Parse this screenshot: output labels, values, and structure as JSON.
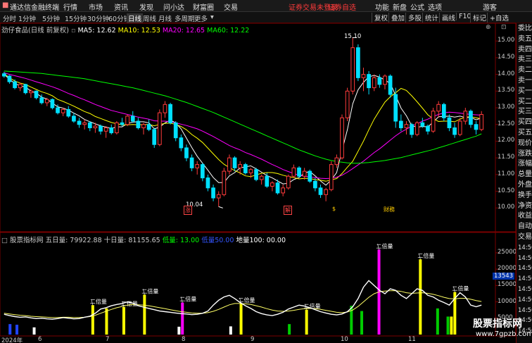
{
  "app": {
    "title": "通达信金融终端",
    "menu": [
      "行情",
      "市场",
      "资讯",
      "发现",
      "问小达",
      "财富圈",
      "交易"
    ],
    "warning": "证券交易未登录",
    "warning2": "证券自选",
    "right_menu": [
      "功能",
      "新盘",
      "公式",
      "选项",
      "游客"
    ]
  },
  "toolbar": {
    "periods": [
      "分时",
      "1分钟",
      "5分钟",
      "15分钟",
      "30分钟",
      "60分钟",
      "日线",
      "周线",
      "月线",
      "多周期",
      "更多"
    ],
    "active": "日线",
    "right": [
      "复权",
      "叠加",
      "多股",
      "统计",
      "画线",
      "F10",
      "标记",
      "+自选"
    ]
  },
  "stock": {
    "name": "劲仔食品(日线 前复权)",
    "ma5": "MA5: 12.62",
    "ma10": "MA10: 12.53",
    "ma20": "MA20: 12.65",
    "ma60": "MA60: 12.22",
    "high_label": "15.10",
    "low_label": "10.04",
    "event_labels": [
      "涨",
      "解",
      "$",
      "财務"
    ]
  },
  "price_axis": [
    "15.00",
    "14.50",
    "14.00",
    "13.50",
    "13.00",
    "12.50",
    "12.00",
    "11.50",
    "11.00",
    "10.50",
    "10.00"
  ],
  "indicator": {
    "name": "股票指标网",
    "five_day": "五日量: 79922.88",
    "ten_day": "十日量: 81155.65",
    "low": "低量: 13.00",
    "low2": "低量50.00",
    "ground": "地量100: 00.00",
    "double_label": "二倍量",
    "current_value": "13543"
  },
  "volume_axis": [
    "25000",
    "20000",
    "15000",
    "10000",
    "5000"
  ],
  "date_axis": [
    "2024年",
    "6",
    "7",
    "8",
    "9",
    "10",
    "11"
  ],
  "right_panel": [
    "委比",
    "卖五",
    "卖四",
    "卖三",
    "卖二",
    "卖一",
    "买一",
    "买二",
    "买三",
    "买四",
    "买五",
    "现价",
    "涨跌",
    "涨幅",
    "总量",
    "外盘",
    "换手",
    "净资",
    "收益",
    "自动",
    "交易",
    "14:50",
    "14:50",
    "14:50",
    "14:50",
    "14:50",
    "14:50",
    "14:50",
    "14:50",
    "14:50"
  ],
  "watermark": "股票指标网",
  "watermark_url": "www.7gpzb.com",
  "colors": {
    "up": "#ff3b3b",
    "down": "#00e0ff",
    "ma5": "#ffffff",
    "ma10": "#ffff00",
    "ma20": "#ff00ff",
    "ma60": "#00ff00",
    "double_vol": "#ffff00",
    "magenta": "#ff00ff",
    "green_bar": "#00cc00"
  },
  "candles": [
    [
      14.02,
      14.08,
      13.9,
      13.95
    ],
    [
      13.95,
      13.98,
      13.72,
      13.78
    ],
    [
      13.78,
      13.85,
      13.55,
      13.6
    ],
    [
      13.6,
      13.75,
      13.5,
      13.7
    ],
    [
      13.7,
      13.72,
      13.4,
      13.45
    ],
    [
      13.45,
      13.55,
      13.3,
      13.5
    ],
    [
      13.5,
      13.52,
      13.25,
      13.3
    ],
    [
      13.3,
      13.4,
      13.1,
      13.15
    ],
    [
      13.15,
      13.3,
      13.05,
      13.25
    ],
    [
      13.25,
      13.28,
      12.95,
      13.0
    ],
    [
      13.0,
      13.1,
      12.8,
      12.85
    ],
    [
      12.85,
      13.0,
      12.75,
      12.95
    ],
    [
      12.95,
      13.05,
      12.7,
      12.75
    ],
    [
      12.75,
      12.85,
      12.55,
      12.6
    ],
    [
      12.6,
      12.7,
      12.4,
      12.5
    ],
    [
      12.5,
      12.65,
      12.35,
      12.55
    ],
    [
      12.55,
      12.6,
      12.3,
      12.4
    ],
    [
      12.4,
      12.55,
      12.25,
      12.45
    ],
    [
      12.45,
      12.5,
      12.2,
      12.3
    ],
    [
      12.3,
      12.45,
      12.1,
      12.4
    ],
    [
      12.4,
      12.5,
      12.2,
      12.25
    ],
    [
      12.25,
      12.6,
      12.2,
      12.55
    ],
    [
      12.55,
      12.7,
      12.45,
      12.5
    ],
    [
      12.5,
      12.8,
      12.45,
      12.75
    ],
    [
      12.75,
      12.9,
      12.55,
      12.6
    ],
    [
      12.6,
      12.7,
      12.35,
      12.4
    ],
    [
      12.4,
      12.55,
      12.2,
      12.5
    ],
    [
      12.5,
      12.65,
      12.3,
      12.35
    ],
    [
      12.35,
      12.4,
      11.8,
      11.9
    ],
    [
      11.9,
      12.95,
      11.85,
      12.85
    ],
    [
      12.85,
      13.2,
      12.7,
      13.1
    ],
    [
      13.1,
      13.15,
      12.5,
      12.55
    ],
    [
      12.55,
      12.6,
      12.0,
      12.1
    ],
    [
      12.1,
      12.2,
      11.7,
      11.8
    ],
    [
      11.8,
      11.9,
      11.4,
      11.5
    ],
    [
      11.5,
      11.6,
      11.1,
      11.2
    ],
    [
      11.2,
      11.4,
      11.0,
      11.3
    ],
    [
      11.3,
      11.35,
      10.8,
      10.9
    ],
    [
      10.9,
      11.0,
      10.5,
      10.6
    ],
    [
      10.6,
      10.7,
      10.2,
      10.3
    ],
    [
      10.3,
      10.5,
      10.04,
      10.4
    ],
    [
      10.4,
      11.2,
      10.35,
      11.1
    ],
    [
      11.1,
      11.6,
      11.0,
      11.5
    ],
    [
      11.5,
      11.55,
      11.1,
      11.2
    ],
    [
      11.2,
      11.4,
      11.0,
      11.3
    ],
    [
      11.3,
      11.35,
      11.0,
      11.05
    ],
    [
      11.05,
      11.2,
      10.9,
      11.15
    ],
    [
      11.15,
      11.2,
      10.8,
      10.85
    ],
    [
      10.85,
      11.0,
      10.7,
      10.95
    ],
    [
      10.95,
      11.05,
      10.6,
      10.65
    ],
    [
      10.65,
      10.8,
      10.5,
      10.75
    ],
    [
      10.75,
      10.85,
      10.4,
      10.45
    ],
    [
      10.45,
      10.7,
      10.35,
      10.6
    ],
    [
      10.6,
      11.0,
      10.55,
      10.95
    ],
    [
      10.95,
      11.3,
      10.9,
      11.2
    ],
    [
      11.2,
      11.25,
      10.9,
      10.95
    ],
    [
      10.95,
      11.2,
      10.85,
      11.1
    ],
    [
      11.1,
      11.15,
      10.75,
      10.8
    ],
    [
      10.8,
      10.9,
      10.5,
      10.6
    ],
    [
      10.6,
      10.7,
      10.3,
      10.4
    ],
    [
      10.4,
      10.6,
      10.2,
      10.55
    ],
    [
      10.55,
      11.4,
      10.5,
      11.3
    ],
    [
      11.3,
      11.6,
      11.2,
      11.5
    ],
    [
      11.5,
      12.8,
      11.45,
      12.7
    ],
    [
      12.7,
      13.6,
      12.6,
      13.5
    ],
    [
      13.5,
      15.1,
      13.4,
      14.8
    ],
    [
      14.8,
      14.9,
      13.8,
      13.9
    ],
    [
      13.9,
      14.2,
      13.5,
      14.0
    ],
    [
      14.0,
      14.1,
      13.4,
      13.6
    ],
    [
      13.6,
      14.0,
      13.5,
      13.9
    ],
    [
      13.9,
      14.0,
      13.6,
      13.7
    ],
    [
      13.7,
      14.0,
      13.55,
      13.95
    ],
    [
      13.95,
      14.0,
      13.3,
      13.4
    ],
    [
      13.4,
      13.6,
      12.4,
      12.6
    ],
    [
      12.6,
      12.8,
      12.3,
      12.4
    ],
    [
      12.4,
      12.6,
      12.2,
      12.5
    ],
    [
      12.5,
      12.55,
      12.1,
      12.2
    ],
    [
      12.2,
      12.6,
      12.15,
      12.55
    ],
    [
      12.55,
      12.7,
      12.4,
      12.45
    ],
    [
      12.45,
      12.5,
      12.2,
      12.3
    ],
    [
      12.3,
      13.0,
      12.25,
      12.9
    ],
    [
      12.9,
      13.2,
      12.7,
      13.1
    ],
    [
      13.1,
      13.15,
      12.6,
      12.7
    ],
    [
      12.7,
      12.8,
      12.3,
      12.4
    ],
    [
      12.4,
      12.55,
      12.1,
      12.2
    ],
    [
      12.2,
      12.7,
      12.15,
      12.6
    ],
    [
      12.6,
      13.0,
      12.5,
      12.9
    ],
    [
      12.9,
      12.95,
      12.4,
      12.5
    ],
    [
      12.5,
      12.6,
      12.2,
      12.35
    ],
    [
      12.35,
      12.9,
      12.3,
      12.8
    ]
  ],
  "ma": {
    "ma5": [
      14.0,
      13.86,
      13.72,
      13.66,
      13.62,
      13.5,
      13.44,
      13.32,
      13.26,
      13.14,
      13.03,
      12.99,
      12.93,
      12.84,
      12.76,
      12.65,
      12.58,
      12.52,
      12.46,
      12.42,
      12.38,
      12.43,
      12.43,
      12.53,
      12.57,
      12.58,
      12.58,
      12.55,
      12.37,
      12.42,
      12.55,
      12.63,
      12.55,
      12.37,
      12.09,
      11.81,
      11.55,
      11.34,
      11.13,
      10.91,
      10.76,
      10.76,
      10.96,
      11.06,
      11.2,
      11.23,
      11.26,
      11.17,
      11.07,
      10.97,
      10.9,
      10.81,
      10.72,
      10.74,
      10.85,
      10.91,
      11.05,
      11.09,
      10.96,
      10.81,
      10.68,
      10.84,
      11.06,
      11.72,
      12.34,
      13.12,
      13.54,
      13.76,
      13.93,
      13.97,
      13.92,
      13.83,
      13.73,
      13.37,
      12.99,
      12.76,
      12.46,
      12.42,
      12.44,
      12.43,
      12.57,
      12.73,
      12.74,
      12.75,
      12.72,
      12.75,
      12.71,
      12.71,
      12.64,
      12.69
    ],
    "ma10": [
      14.02,
      13.9,
      13.8,
      13.74,
      13.7,
      13.62,
      13.55,
      13.48,
      13.43,
      13.36,
      13.25,
      13.19,
      13.12,
      13.05,
      12.97,
      12.89,
      12.83,
      12.74,
      12.68,
      12.62,
      12.56,
      12.52,
      12.49,
      12.49,
      12.5,
      12.49,
      12.5,
      12.5,
      12.46,
      12.5,
      12.53,
      12.54,
      12.5,
      12.44,
      12.34,
      12.2,
      12.09,
      11.96,
      11.79,
      11.62,
      11.45,
      11.31,
      11.21,
      11.12,
      11.05,
      10.96,
      10.94,
      10.99,
      11.04,
      11.06,
      11.06,
      11.03,
      10.98,
      10.94,
      10.91,
      10.87,
      10.89,
      10.88,
      10.85,
      10.83,
      10.8,
      10.84,
      10.88,
      11.03,
      11.22,
      11.4,
      11.7,
      12.0,
      12.34,
      12.66,
      12.92,
      13.17,
      13.33,
      13.45,
      13.58,
      13.52,
      13.36,
      13.18,
      12.99,
      12.79,
      12.67,
      12.59,
      12.6,
      12.6,
      12.58,
      12.66,
      12.72,
      12.73,
      12.7,
      12.67
    ],
    "ma20": [
      14.05,
      14.0,
      13.96,
      13.92,
      13.88,
      13.83,
      13.78,
      13.73,
      13.68,
      13.63,
      13.57,
      13.5,
      13.43,
      13.37,
      13.3,
      13.24,
      13.17,
      13.1,
      13.04,
      12.98,
      12.92,
      12.88,
      12.84,
      12.8,
      12.76,
      12.72,
      12.69,
      12.66,
      12.61,
      12.6,
      12.6,
      12.58,
      12.55,
      12.51,
      12.47,
      12.42,
      12.37,
      12.3,
      12.22,
      12.14,
      12.05,
      11.96,
      11.87,
      11.8,
      11.74,
      11.66,
      11.6,
      11.53,
      11.46,
      11.38,
      11.3,
      11.23,
      11.15,
      11.09,
      11.03,
      10.98,
      10.95,
      10.93,
      10.91,
      10.89,
      10.88,
      10.89,
      10.92,
      10.98,
      11.07,
      11.18,
      11.29,
      11.4,
      11.53,
      11.66,
      11.77,
      11.9,
      12.03,
      12.16,
      12.27,
      12.36,
      12.45,
      12.52,
      12.6,
      12.66,
      12.74,
      12.8,
      12.85,
      12.87,
      12.86,
      12.84,
      12.82,
      12.8,
      12.79,
      12.78
    ],
    "ma60": [
      14.1,
      14.09,
      14.08,
      14.07,
      14.06,
      14.05,
      14.04,
      14.03,
      14.01,
      13.99,
      13.97,
      13.95,
      13.93,
      13.91,
      13.89,
      13.87,
      13.84,
      13.81,
      13.78,
      13.75,
      13.72,
      13.69,
      13.66,
      13.63,
      13.6,
      13.56,
      13.52,
      13.48,
      13.44,
      13.4,
      13.36,
      13.31,
      13.26,
      13.21,
      13.16,
      13.1,
      13.04,
      12.98,
      12.92,
      12.86,
      12.79,
      12.72,
      12.65,
      12.58,
      12.51,
      12.44,
      12.37,
      12.3,
      12.23,
      12.16,
      12.09,
      12.02,
      11.95,
      11.88,
      11.81,
      11.74,
      11.68,
      11.62,
      11.56,
      11.51,
      11.46,
      11.42,
      11.39,
      11.37,
      11.35,
      11.34,
      11.34,
      11.35,
      11.36,
      11.38,
      11.4,
      11.42,
      11.45,
      11.48,
      11.51,
      11.55,
      11.59,
      11.63,
      11.67,
      11.71,
      11.75,
      11.8,
      11.85,
      11.9,
      11.95,
      12.0,
      12.05,
      12.1,
      12.15,
      12.22
    ]
  },
  "volume_line1": [
    6200,
    5800,
    5500,
    5300,
    5400,
    5100,
    4900,
    5000,
    4800,
    4700,
    4900,
    5200,
    5000,
    4800,
    4900,
    5300,
    5600,
    6500,
    7800,
    8200,
    8800,
    9200,
    9500,
    10000,
    9600,
    8800,
    8400,
    8000,
    7600,
    7200,
    7000,
    6800,
    6600,
    6400,
    6300,
    6100,
    6200,
    6500,
    7200,
    9000,
    10500,
    11500,
    12000,
    11000,
    9800,
    8800,
    8000,
    7000,
    6400,
    6000,
    5800,
    6200,
    6800,
    7800,
    8400,
    9000,
    8700,
    8200,
    7600,
    7000,
    6600,
    6200,
    6000,
    6300,
    7000,
    8500,
    11000,
    14500,
    16500,
    15000,
    13500,
    12500,
    14000,
    13500,
    12000,
    11000,
    12500,
    14000,
    13500,
    12000,
    11500,
    10500,
    9800,
    9000,
    11000,
    12800,
    11500,
    9000,
    8500,
    9000
  ],
  "volume_line2": [
    6500,
    6300,
    6100,
    5900,
    5800,
    5600,
    5500,
    5400,
    5300,
    5200,
    5200,
    5300,
    5300,
    5200,
    5200,
    5300,
    5500,
    5900,
    6500,
    7100,
    7700,
    8200,
    8600,
    9000,
    9200,
    9100,
    9000,
    8800,
    8500,
    8200,
    7900,
    7600,
    7300,
    7000,
    6800,
    6600,
    6500,
    6500,
    6700,
    7100,
    7700,
    8400,
    9100,
    9500,
    9500,
    9400,
    9200,
    8800,
    8400,
    7900,
    7500,
    7200,
    7100,
    7200,
    7400,
    7700,
    7900,
    8000,
    7900,
    7700,
    7400,
    7100,
    6800,
    6700,
    6900,
    7500,
    8600,
    10000,
    11400,
    12500,
    13100,
    13300,
    13400,
    13400,
    13200,
    12800,
    12600,
    12700,
    12800,
    12600,
    12300,
    11900,
    11400,
    11000,
    10900,
    11100,
    11100,
    10800,
    10400,
    10100
  ],
  "bars": [
    {
      "i": 2,
      "v": 3200,
      "c": "blue"
    },
    {
      "i": 4,
      "v": 3000,
      "c": "blue"
    },
    {
      "i": 9,
      "v": 2200,
      "c": "white"
    },
    {
      "i": 26,
      "v": 9000,
      "c": "yellow",
      "lbl": true
    },
    {
      "i": 30,
      "v": 8000,
      "c": "yellow"
    },
    {
      "i": 35,
      "v": 8400,
      "c": "yellow",
      "lbl": true
    },
    {
      "i": 41,
      "v": 12200,
      "c": "yellow",
      "lbl": true
    },
    {
      "i": 51,
      "v": 2400,
      "c": "white"
    },
    {
      "i": 52,
      "v": 9800,
      "c": "magenta",
      "lbl": true
    },
    {
      "i": 66,
      "v": 2500,
      "c": "white"
    },
    {
      "i": 69,
      "v": 9500,
      "c": "yellow",
      "lbl": true
    },
    {
      "i": 83,
      "v": 3200,
      "c": "green"
    },
    {
      "i": 88,
      "v": 7600,
      "c": "yellow",
      "lbl": true
    },
    {
      "i": 101,
      "v": 8800,
      "c": "green"
    },
    {
      "i": 104,
      "v": 7200,
      "c": "green"
    },
    {
      "i": 109,
      "v": 26000,
      "c": "magenta",
      "lbl": true
    },
    {
      "i": 121,
      "v": 23000,
      "c": "yellow",
      "lbl": true
    },
    {
      "i": 126,
      "v": 8000,
      "c": "green"
    },
    {
      "i": 129,
      "v": 5500,
      "c": "green"
    },
    {
      "i": 130,
      "v": 5500,
      "c": "yellow"
    },
    {
      "i": 131,
      "v": 13000,
      "c": "yellow",
      "lbl": true
    }
  ]
}
